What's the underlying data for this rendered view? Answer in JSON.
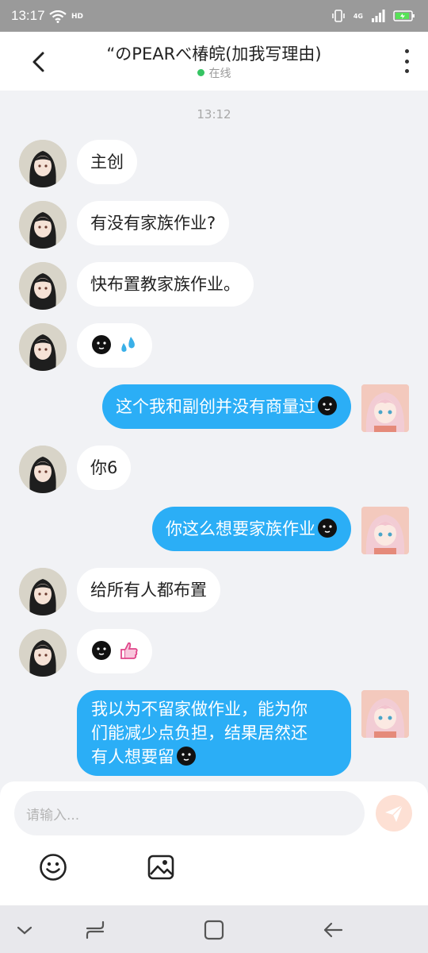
{
  "status_bar": {
    "time": "13:17",
    "hd": "HD",
    "network": "4G"
  },
  "header": {
    "title": "“のPEARべ椿皖(加我写理由)",
    "status": "在线"
  },
  "chat": {
    "timestamp": "13:12",
    "messages": [
      {
        "side": "in",
        "text": "主创"
      },
      {
        "side": "in",
        "text": "有没有家族作业?"
      },
      {
        "side": "in",
        "text": "快布置教家族作业。"
      },
      {
        "side": "in",
        "text": "",
        "emoji": [
          "black-face",
          "sweat-drops"
        ]
      },
      {
        "side": "out",
        "text": "这个我和副创并没有商量过",
        "emoji": [
          "black-face"
        ]
      },
      {
        "side": "in",
        "text": "你6"
      },
      {
        "side": "out",
        "text": "你这么想要家族作业",
        "emoji": [
          "black-face"
        ]
      },
      {
        "side": "in",
        "text": "给所有人都布置"
      },
      {
        "side": "in",
        "text": "",
        "emoji": [
          "black-face",
          "thumbs-up"
        ]
      },
      {
        "side": "out",
        "lines": [
          "我以为不留家做作业，能为你",
          "们能减少点负担，结果居然还",
          "有人想要留"
        ],
        "emoji": [
          "black-face"
        ]
      }
    ]
  },
  "composer": {
    "placeholder": "请输入..."
  },
  "icons": {
    "back": "chevron-left-icon",
    "more": "more-vertical-icon",
    "send": "paper-plane-icon",
    "emoji": "smiley-icon",
    "image": "image-icon"
  },
  "colors": {
    "accent": "#2baef6",
    "online": "#36c463",
    "send_disabled": "#fde0d4"
  }
}
